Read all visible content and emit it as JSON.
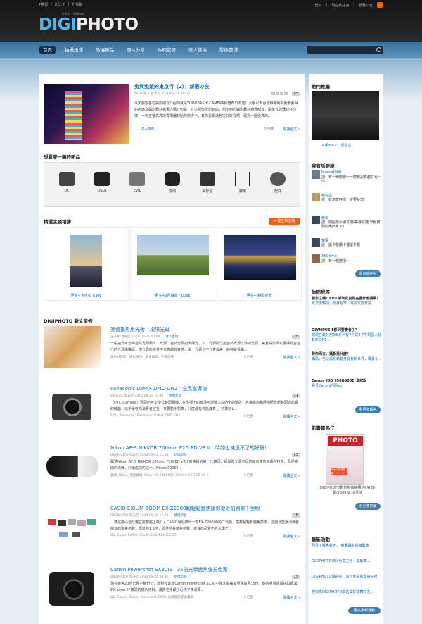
{
  "top": {
    "links": [
      "T香邦",
      "比比王",
      "打電動"
    ],
    "right": [
      "登入",
      "現在就註冊",
      "服務公告"
    ],
    "tagline": "你是誰・美麗無敵"
  },
  "logo": {
    "a": "DIGI",
    "b": "PHOTO"
  },
  "nav": [
    "首頁",
    "拍攝技法",
    "哈燒新品",
    "照片分享",
    "你問我答",
    "達人基地",
    "影像書城"
  ],
  "feature": {
    "title": "兔與兔娘的東京行（2）：新宿の夜",
    "meta": "Alrist 兔子 發表於 2010-09-26 10:00",
    "count": "45",
    "body": "今天要跟各位攝影朋友介紹的就是YODOBASHI CAMERA新宿西口本店！大家以為台北相機街中衝衝衝相的店面及攝影器材夠驚人嗎？但是！在這裡你所想到的，想不到的攝影器材通通都有，開架式的器材任你摸！一到五樓高高的賣場器材給你挑得卡，真的是相通趕得好好買啊！逛完一圈後真的...",
    "tag": "達人基地",
    "replies": "0 回應",
    "more": "閱讀全文 »"
  },
  "cats": {
    "title": "想看哪一類的新品",
    "items": [
      "DC",
      "DSLR",
      "EVIL",
      "鏡頭",
      "攝影包",
      "腳架",
      "配件"
    ]
  },
  "albums": {
    "title": "精選主題相簿",
    "btn": "+ 建立新主題",
    "items": [
      "更多+卡密拉 & Me",
      "更多+9月攝寮・LOVE",
      "更多+金橋 夜景"
    ]
  },
  "news_title": "DIGIPHOTO 新文發佈",
  "posts": [
    {
      "title": "美食攝影用光術　現場光篇",
      "meta": "王子多 發表於 2010-09-25 10:00",
      "cat": "達人基地",
      "count": "28",
      "body": "一般拍光可分為自然光源跟人工光源，自然光源指太陽光，人工光源則泛指自然光源以外的光源，美食攝影師可選擇適合自己的光源來攝影，但光源能多並不代表越有質感，單一光源也不代表最差，純粹是看攝...",
      "tags": "強拍好料達、攝影技巧、美食攝影、吃喝玩樂",
      "replies": "0 回應",
      "more": "閱讀全文 »"
    },
    {
      "title": "Panasonic LUMIX DMC-GH2　全民當導演",
      "meta": "Vessuka 發表於 2010-09-25 10:00",
      "cat": "哈燒新品",
      "count": "21",
      "body": "「EVIL Camera」邪惡的可交換式鏡頭相機，在市場上的競爭可謂進入白熱化的階段，各家廠商積極地研發新鏡頭的影響的機動，似乎是在向消費者宣告「只要動手想像，什麼都有可能成真」」初陣子L...",
      "tags": "EVIL, Panasonic, Panasonic LUMIX DMC-GH2",
      "replies": "0 回應",
      "more": "閱讀全文 »"
    },
    {
      "title": "Nikon AF-S NIKKOR 200mm F2G ED VR II　時間也凍沒不了的好鏡！",
      "meta": "DIGIPHOTO 發表於 2010-09-24 11:00",
      "cat": "哈燒新品",
      "count": "23",
      "body": "聰慧Nikon AF-S NIKKOR 200mm F2G ED VR II高焦段的第一代鏡頭，是專為光源不足的室內體育競賽所打造，歷經時間的洗練，評價趨同的這一，Nikon於2005...",
      "tags": "鏡頭, Nikon, 定焦鏡頭, Nikon AF-S NIKKOR 200mm F2G ED VR II",
      "replies": "0 回應",
      "more": "閱讀全文 »"
    },
    {
      "title": "CASIO EXILIM ZOOM EX-Z2300超輕鬆變焦讓你從近拍到樂千里眼",
      "meta": "DIGIPHOTO 發表於 2010-09-24 12:00",
      "cat": "哈燒新品",
      "count": "16",
      "body": "「總是擔心自己離在框靶點上嗎？」CASIO最近推出一款EX-Z20000的二代機，搭載超輕析變焦技術，這個功能讓消費者擁有的變焦倍數，再延伸1.5倍；即使拉長變焦倍數，依會的品質仍在水準之...",
      "tags": "DC, Casio, CASIO EXILIM ZOOM EX-Z2300",
      "replies": "0 回應",
      "more": "閱讀全文 »"
    },
    {
      "title": "Canon Powershot SX30IS　35倍光學變焦偏拍免驚！",
      "meta": "DIGIPHOTO 發表於 2010-09-24 08:30",
      "cat": "哈燒新品",
      "count": "15",
      "body": "現在變焦20倍已經不稀奇了，隨科技進步Canon Powershot SX30不僅大幅擴寬望遠端至35倍，鏡片材質還是採取專業的Canon EF鏡頭的鏡片用料，畫質也長顯示近視了焦成果...",
      "tags": "DC, Canon, Canon Powershot SX30, 遠端攝影望遠鏡頭",
      "replies": "0 回應",
      "more": "閱讀全文 »"
    }
  ],
  "side": {
    "hot": {
      "title": "熱門推薦",
      "caption": "叫我No.1　冒險企..."
    },
    "talk": {
      "title": "我有話要說",
      "btn": "還有誰在說",
      "items": [
        {
          "name": "bluecat900",
          "msg": "說：有一律用聊一一感覺說來越好看～～"
        },
        {
          "name": "龍先生",
          "msg": "說：有這麼好壞一定要參加"
        },
        {
          "name": "兔軍",
          "msg": "說：開始存小朋友吧(等存好錢,早就被別的東西拿下)"
        },
        {
          "name": "兔軍",
          "msg": "說：讓卡種講卡種讓卡種"
        },
        {
          "name": "AKGtime",
          "msg": "說：有一種變壞～"
        }
      ]
    },
    "qa": {
      "title": "你問我答",
      "btn": "看更多解答",
      "items": [
        {
          "q": "要您之幡？EVIL係既究竟是在護什麼要事？",
          "a": "可交換鏡頭、機身短窄，電子式觀景窗..."
        },
        {
          "q": "OLYMPUS E係列要變者了？",
          "a": "觀現在最好用的E系列有7可是E-P不現歐入比較新E-P1..."
        },
        {
          "q": "對你而言，攝影是什麼？",
          "a": "攝影，可以讓我執敵身有看新世界，職員 (..."
        },
        {
          "q": "Canon 60D 550D500D 測試版",
          "a": "看見Canon的那iso"
        }
      ]
    },
    "book": {
      "title": "新書報馬仔",
      "caption": "DIGIPHOTO數位相機採購 用 第39期/2009 9.10月號",
      "btn": "看更多好書",
      "cover_brand": "PHOTO",
      "cover_label": "Motel 寫真特輯"
    },
    "events": {
      "title": "最新活動",
      "btn": "更多最新活動",
      "items": [
        "而見了羅鼻者大、 競郵攝影揮舞取像",
        "DIGIPHOTO照片分享主題　攝影舞...",
        "DIGIPHOTO開站啦　加入會員資雲拍好禮",
        "趕快來DIGIPHOTO網站攝影揮舞好名..."
      ]
    }
  }
}
